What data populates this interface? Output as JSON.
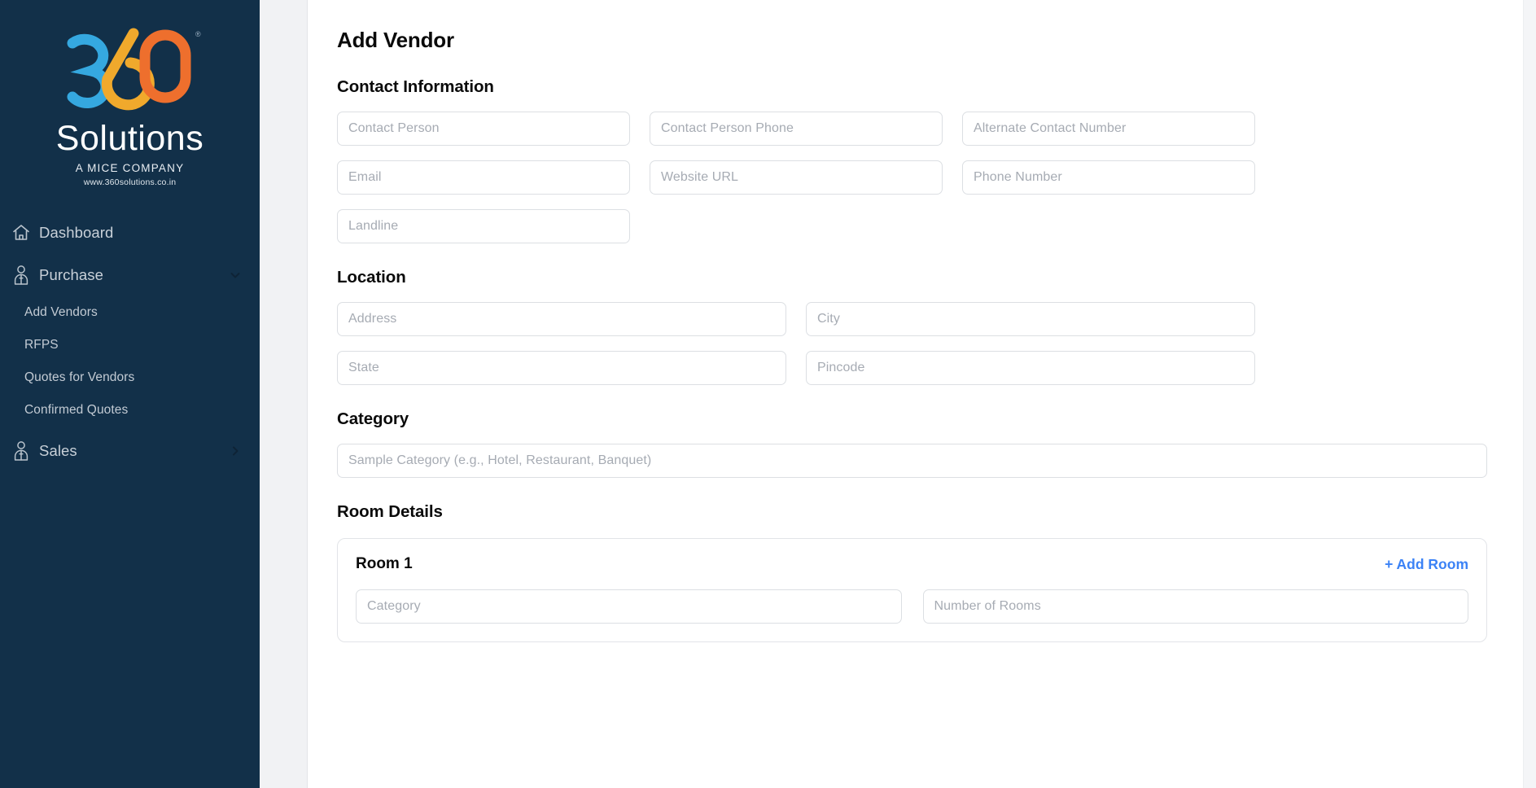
{
  "brand": {
    "logo_number": "360",
    "logo_word": "Solutions",
    "logo_tagline": "A MICE COMPANY",
    "logo_url": "www.360solutions.co.in",
    "colors": {
      "sidebar_bg": "#123049",
      "logo_blue": "#35a8e0",
      "logo_yellow": "#f0a92c",
      "logo_orange": "#ee6f2d",
      "accent_link": "#3b82f6"
    }
  },
  "sidebar": {
    "items": [
      {
        "label": "Dashboard",
        "icon": "home-icon",
        "chevron": ""
      },
      {
        "label": "Purchase",
        "icon": "user-tie-icon",
        "chevron": "chevron-down-icon"
      },
      {
        "label": "Sales",
        "icon": "user-tie-icon",
        "chevron": "chevron-right-icon"
      }
    ],
    "purchase_children": [
      {
        "label": "Add Vendors"
      },
      {
        "label": "RFPS"
      },
      {
        "label": "Quotes for Vendors"
      },
      {
        "label": "Confirmed Quotes"
      }
    ]
  },
  "page": {
    "title": "Add Vendor",
    "sections": {
      "contact": {
        "title": "Contact Information",
        "fields": [
          {
            "placeholder": "Contact Person",
            "value": ""
          },
          {
            "placeholder": "Contact Person Phone",
            "value": ""
          },
          {
            "placeholder": "Alternate Contact Number",
            "value": ""
          },
          {
            "placeholder": "Email",
            "value": ""
          },
          {
            "placeholder": "Website URL",
            "value": ""
          },
          {
            "placeholder": "Phone Number",
            "value": ""
          },
          {
            "placeholder": "Landline",
            "value": ""
          }
        ]
      },
      "location": {
        "title": "Location",
        "fields": [
          {
            "placeholder": "Address",
            "value": ""
          },
          {
            "placeholder": "City",
            "value": ""
          },
          {
            "placeholder": "State",
            "value": ""
          },
          {
            "placeholder": "Pincode",
            "value": ""
          }
        ]
      },
      "category": {
        "title": "Category",
        "fields": [
          {
            "placeholder": "Sample Category (e.g., Hotel, Restaurant, Banquet)",
            "value": ""
          }
        ]
      },
      "room_details": {
        "title": "Room Details",
        "add_room_label": "+ Add Room",
        "rooms": [
          {
            "title": "Room 1",
            "fields": [
              {
                "placeholder": "Category",
                "value": ""
              },
              {
                "placeholder": "Number of Rooms",
                "value": ""
              }
            ]
          }
        ]
      }
    }
  }
}
